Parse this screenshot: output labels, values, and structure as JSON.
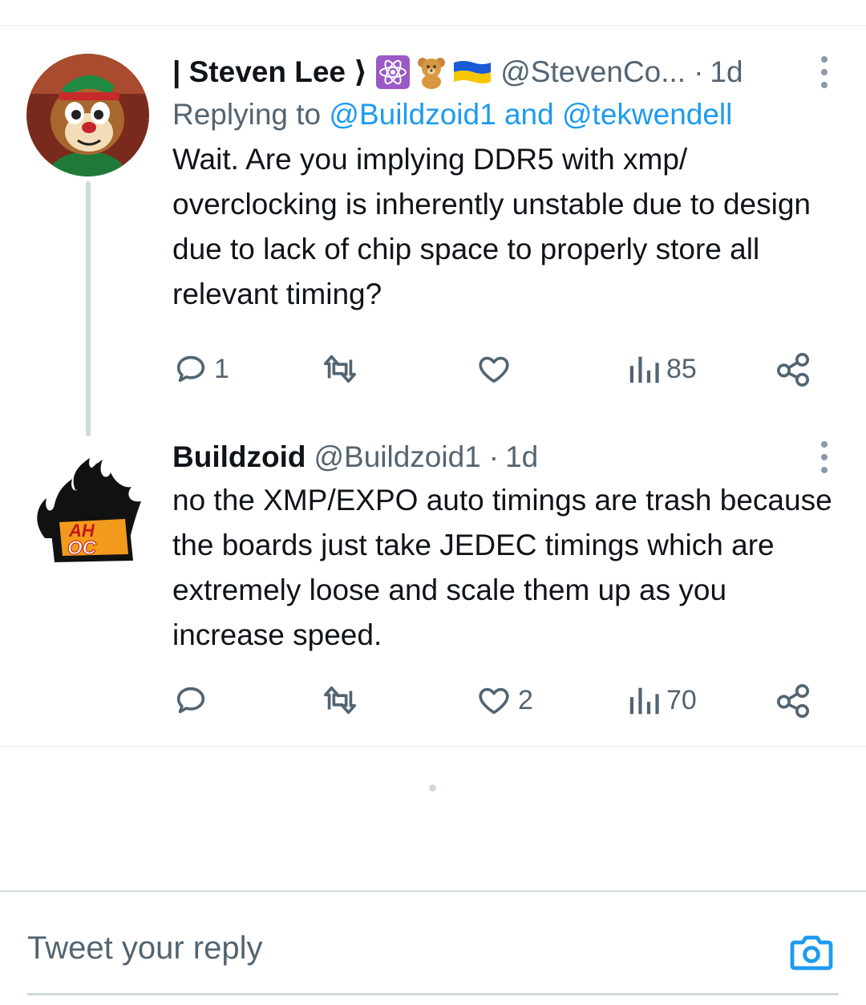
{
  "tweets": [
    {
      "display_name": "| Steven Lee ⟩",
      "badges": [
        "atom-emoji",
        "teddy-bear-emoji",
        "ukraine-flag-emoji"
      ],
      "handle": "@StevenCo...",
      "dot": "·",
      "time": "1d",
      "replying_prefix": "Replying to",
      "replying_to_1": "@Buildzoid1",
      "replying_and": "and",
      "replying_to_2": "@tekwendell",
      "text": "Wait. Are you implying DDR5 with xmp/ overclocking is inherently unstable due to design due to lack of chip space to properly store all relevant timing?",
      "replies": "1",
      "retweets": "",
      "likes": "",
      "views": "85"
    },
    {
      "display_name": "Buildzoid",
      "handle": "@Buildzoid1",
      "dot": "·",
      "time": "1d",
      "text": "no the XMP/EXPO auto timings are trash because the boards just take JEDEC timings which are extremely loose and scale them up as you increase speed.",
      "replies": "",
      "retweets": "",
      "likes": "2",
      "views": "70",
      "avatar_text_1": "AH",
      "avatar_text_2": "OC"
    }
  ],
  "reply_bar": {
    "placeholder": "Tweet your reply"
  },
  "colors": {
    "accent": "#1d9bf0",
    "secondary_text": "#536471",
    "divider": "#e6ecf0"
  }
}
